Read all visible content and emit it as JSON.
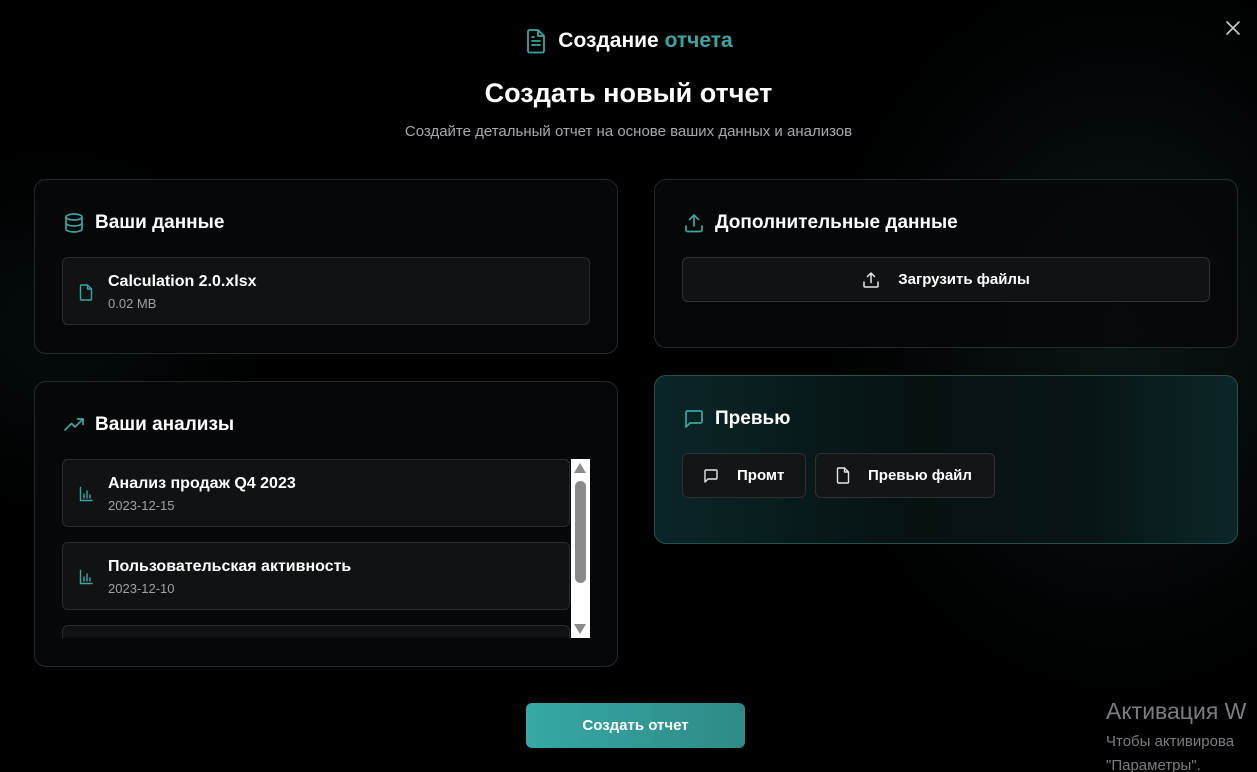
{
  "header": {
    "title_main": "Создание",
    "title_accent": "отчета",
    "icon": "file-text-icon",
    "accent_color": "#3aa6a0"
  },
  "main_title": "Создать новый отчет",
  "subtitle": "Создайте детальный отчет на основе ваших данных и анализов",
  "your_data": {
    "title": "Ваши данные",
    "icon": "database-icon",
    "file": {
      "name": "Calculation 2.0.xlsx",
      "size": "0.02 MB",
      "icon": "file-icon"
    }
  },
  "additional_data": {
    "title": "Дополнительные данные",
    "icon": "upload-icon",
    "upload_label": "Загрузить файлы"
  },
  "your_analyses": {
    "title": "Ваши анализы",
    "icon": "trending-up-icon",
    "items": [
      {
        "name": "Анализ продаж Q4 2023",
        "date": "2023-12-15",
        "icon": "bar-chart-icon"
      },
      {
        "name": "Пользовательская активность",
        "date": "2023-12-10",
        "icon": "bar-chart-icon"
      }
    ]
  },
  "preview": {
    "title": "Превью",
    "icon": "message-square-icon",
    "prompt_label": "Промт",
    "preview_file_label": "Превью файл"
  },
  "create_button": "Создать отчет",
  "watermark": {
    "title": "Активация W",
    "line1": "Чтобы активирова",
    "line2": "\"Параметры\"."
  }
}
